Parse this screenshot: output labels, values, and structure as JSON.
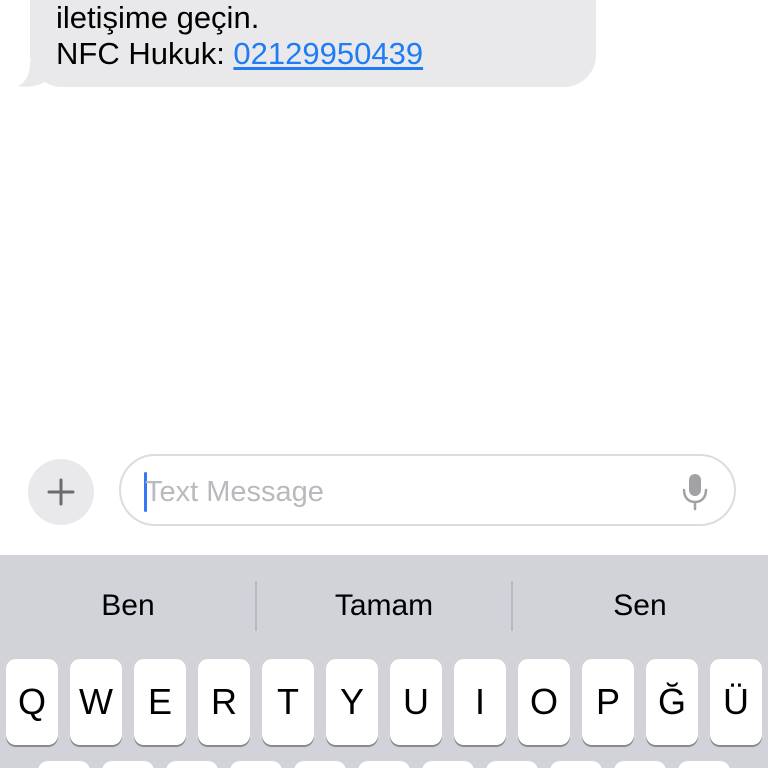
{
  "message": {
    "line1": "iletişime geçin.",
    "line2_prefix": "NFC Hukuk: ",
    "phone_link": "02129950439"
  },
  "compose": {
    "add_icon": "plus-icon",
    "placeholder": "Text Message",
    "mic_icon": "microphone-icon"
  },
  "keyboard": {
    "suggestions": [
      "Ben",
      "Tamam",
      "Sen"
    ],
    "row1": [
      "Q",
      "W",
      "E",
      "R",
      "T",
      "Y",
      "U",
      "I",
      "O",
      "P",
      "Ğ",
      "Ü"
    ]
  },
  "colors": {
    "link": "#1f7cf5",
    "bubble": "#e9e9eb",
    "keyboard_bg": "#d1d3d9",
    "caret": "#3478f6"
  }
}
